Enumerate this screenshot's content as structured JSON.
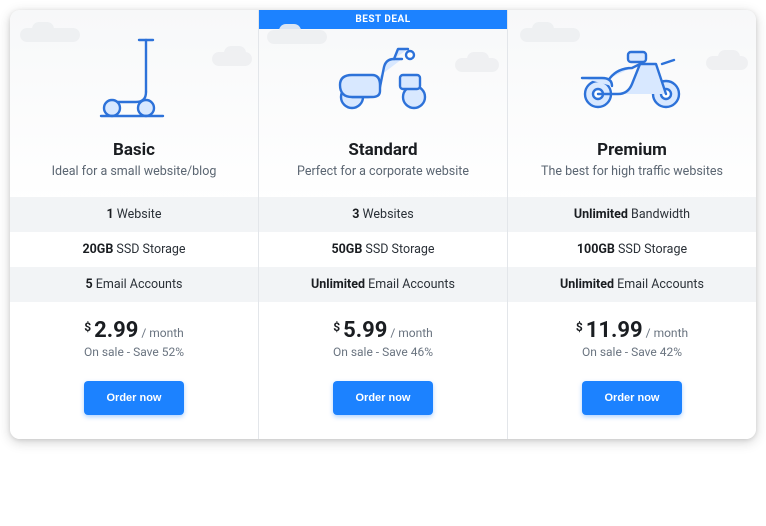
{
  "badge": "BEST DEAL",
  "plans": [
    {
      "icon": "scooter-icon",
      "title": "Basic",
      "subtitle": "Ideal for a small website/blog",
      "features": [
        {
          "bold": "1",
          "rest": " Website"
        },
        {
          "bold": "20GB",
          "rest": " SSD Storage"
        },
        {
          "bold": "5",
          "rest": " Email Accounts"
        }
      ],
      "currency": "$",
      "amount": "2.99",
      "period": "/ month",
      "sale": "On sale - Save 52%",
      "cta": "Order now"
    },
    {
      "icon": "moped-icon",
      "badge": true,
      "title": "Standard",
      "subtitle": "Perfect for a corporate website",
      "features": [
        {
          "bold": "3",
          "rest": " Websites"
        },
        {
          "bold": "50GB",
          "rest": " SSD Storage"
        },
        {
          "bold": "Unlimited",
          "rest": " Email Accounts"
        }
      ],
      "currency": "$",
      "amount": "5.99",
      "period": "/ month",
      "sale": "On sale - Save 46%",
      "cta": "Order now"
    },
    {
      "icon": "motorcycle-icon",
      "title": "Premium",
      "subtitle": "The best for high traffic websites",
      "features": [
        {
          "bold": "Unlimited",
          "rest": " Bandwidth"
        },
        {
          "bold": "100GB",
          "rest": " SSD Storage"
        },
        {
          "bold": "Unlimited",
          "rest": " Email Accounts"
        }
      ],
      "currency": "$",
      "amount": "11.99",
      "period": "/ month",
      "sale": "On sale - Save 42%",
      "cta": "Order now"
    }
  ]
}
